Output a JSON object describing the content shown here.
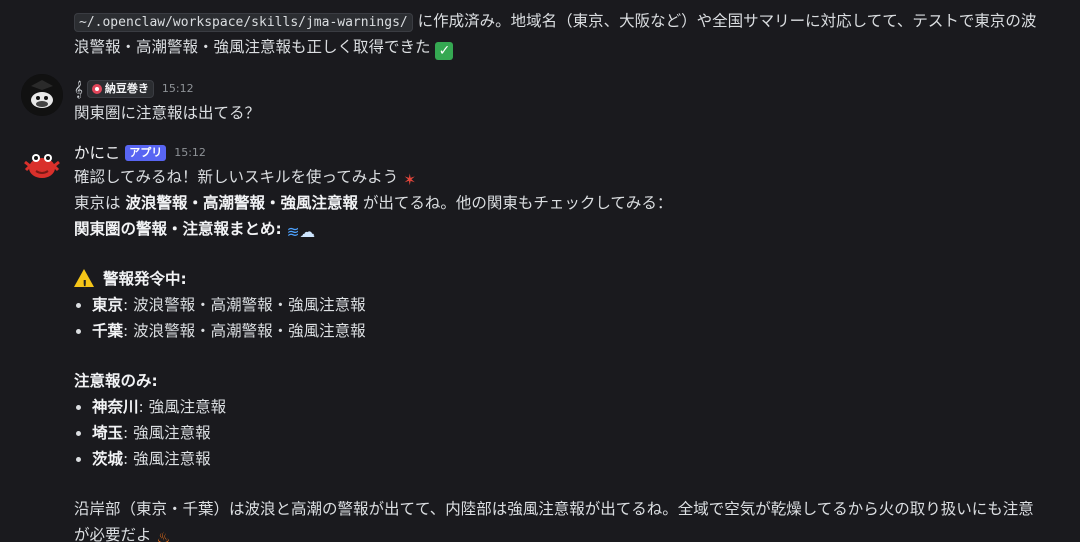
{
  "prev_message": {
    "code_path": "~/.openclaw/workspace/skills/jma-warnings/",
    "text_line1": " に作成済み。地域名（東京、大阪など）や全国サマリーに対応してて、テストで東京の波",
    "text_line2": "浪警報・高潮警報・強風注意報も正しく取得できた",
    "emoji": "✅"
  },
  "user_message": {
    "prefix_icon": "ߑ",
    "role_name": "納豆巻き",
    "time": "15:12",
    "text": "関東圏に注意報は出てる？"
  },
  "bot_message": {
    "username": "かにこ",
    "app_badge": "アプリ",
    "time": "15:12",
    "line1": "確認してみるね！新しいスキルを使ってみよう",
    "line1_emoji": "ߦ",
    "line2_prefix": "東京は ",
    "line2_bold": "波浪警報・高潮警報・強風注意報",
    "line2_suffix": " が出てるね。他の関東もチェックしてみる：",
    "summary_title": "関東圏の警報・注意報まとめ:",
    "summary_emoji": "ߌ㰟a8",
    "warning_header": "警報発令中:",
    "warnings": [
      {
        "region": "東京",
        "text": ": 波浪警報・高潮警報・強風注意報"
      },
      {
        "region": "千葉",
        "text": ": 波浪警報・高潮警報・強風注意報"
      }
    ],
    "advisory_header": "注意報のみ:",
    "advisories": [
      {
        "region": "神奈川",
        "text": ": 強風注意報"
      },
      {
        "region": "埼玉",
        "text": ": 強風注意報"
      },
      {
        "region": "茨城",
        "text": ": 強風注意報"
      }
    ],
    "closing_line1": "沿岸部（東京・千葉）は波浪と高潮の警報が出てて、内陸部は強風注意報が出てるね。全域で空気が乾燥してるから火の取り扱いにも注意",
    "closing_line2": "が必要だよ",
    "closing_emoji": "ߔ"
  }
}
